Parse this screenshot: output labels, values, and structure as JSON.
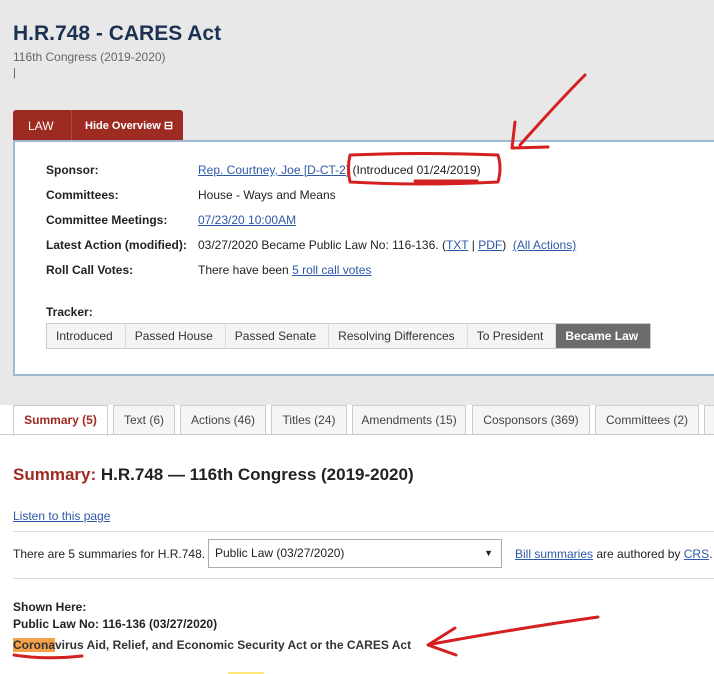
{
  "bill": {
    "title": "H.R.748 - CARES Act",
    "congress": "116th Congress (2019-2020)",
    "cursor": "|"
  },
  "overview": {
    "law_label": "LAW",
    "hide_label": "Hide Overview ⊟",
    "sponsor_label": "Sponsor:",
    "sponsor_name": "Rep. Courtney, Joe [D-CT-2]",
    "introduced_prefix": "(Introduced ",
    "introduced_date": "01/24/2019",
    "introduced_suffix": ")",
    "committees_label": "Committees:",
    "committees_value": "House - Ways and Means",
    "meetings_label": "Committee Meetings:",
    "meetings_value": "07/23/20 10:00AM",
    "latest_label": "Latest Action (modified):",
    "latest_value": "03/27/2020 Became Public Law No: 116-136. (",
    "latest_txt": "TXT",
    "latest_sep": " | ",
    "latest_pdf": "PDF",
    "latest_close": ")",
    "all_actions": "(All Actions)",
    "rollcall_label": "Roll Call Votes:",
    "rollcall_prefix": "There have been ",
    "rollcall_link": "5 roll call votes",
    "tracker_label": "Tracker:",
    "tracker_steps": [
      "Introduced",
      "Passed House",
      "Passed Senate",
      "Resolving Differences",
      "To President",
      "Became Law"
    ]
  },
  "tabs": [
    "Summary (5)",
    "Text (6)",
    "Actions (46)",
    "Titles (24)",
    "Amendments (15)",
    "Cosponsors (369)",
    "Committees (2)"
  ],
  "summary": {
    "heading_prefix": "Summary:",
    "heading_rest": " H.R.748 — 116th Congress (2019-2020)",
    "listen": "Listen to this page",
    "count_text": "There are 5 summaries for H.R.748.",
    "select_value": "Public Law (03/27/2020)",
    "bill_summaries": "Bill summaries",
    "authored_text": " are authored by ",
    "crs": "CRS",
    "authored_end": ".",
    "shown_here": "Shown Here:",
    "public_law": "Public Law No: 116-136 (03/27/2020)",
    "act_highlight": "Corona",
    "act_rest": "virus Aid, Relief, and Economic Security Act or the CARES Act"
  },
  "colors": {
    "law_red": "#9d2b22",
    "link_blue": "#2c59a8",
    "annotation_red": "#d42020",
    "highlight_orange": "#f5a14a"
  }
}
